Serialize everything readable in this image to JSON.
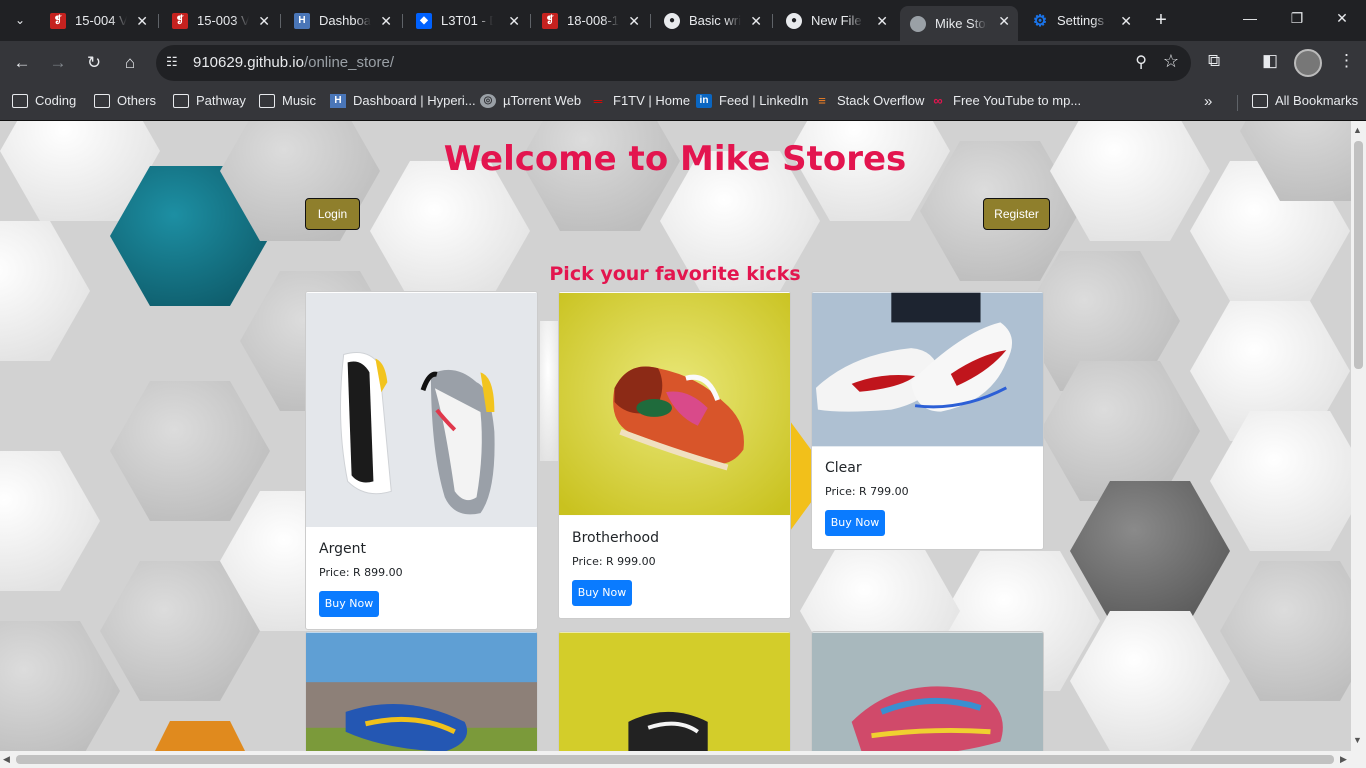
{
  "browser": {
    "tabs": [
      {
        "title": "15-004 Ve",
        "favicon": "pdf-icon",
        "color": "#c5221f"
      },
      {
        "title": "15-003 Ve",
        "favicon": "pdf-icon",
        "color": "#c5221f"
      },
      {
        "title": "Dashboar",
        "favicon": "hyperion-icon",
        "color": "#4a76b8"
      },
      {
        "title": "L3T01 - D",
        "favicon": "dropbox-icon",
        "color": "#0061fe"
      },
      {
        "title": "18-008-1",
        "favicon": "pdf-icon",
        "color": "#c5221f"
      },
      {
        "title": "Basic writ",
        "favicon": "github-icon",
        "color": "#e8eaed"
      },
      {
        "title": "New File",
        "favicon": "github-icon",
        "color": "#e8eaed"
      },
      {
        "title": "Mike Stor",
        "favicon": "globe-icon",
        "color": "#9aa0a6"
      },
      {
        "title": "Settings -",
        "favicon": "gear-icon",
        "color": "#1a73e8"
      }
    ],
    "active_tab_index": 7,
    "url_host": "910629.github.io",
    "url_path": "/online_store/",
    "bookmarks": [
      {
        "label": "Coding",
        "icon": "folder-icon"
      },
      {
        "label": "Others",
        "icon": "folder-icon"
      },
      {
        "label": "Pathway",
        "icon": "folder-icon"
      },
      {
        "label": "Music",
        "icon": "folder-icon"
      },
      {
        "label": "Dashboard | Hyperi...",
        "icon": "hyperion-icon"
      },
      {
        "label": "µTorrent Web",
        "icon": "globe-icon"
      },
      {
        "label": "F1TV | Home",
        "icon": "f1-icon"
      },
      {
        "label": "Feed | LinkedIn",
        "icon": "linkedin-icon"
      },
      {
        "label": "Stack Overflow",
        "icon": "stackoverflow-icon"
      },
      {
        "label": "Free YouTube to mp...",
        "icon": "link-icon"
      }
    ],
    "all_bookmarks_label": "All Bookmarks"
  },
  "page": {
    "title": "Welcome to Mike Stores",
    "login_label": "Login",
    "register_label": "Register",
    "subtitle": "Pick your favorite kicks",
    "accent_color": "#e3154f",
    "button_color": "#8f7f2c",
    "buy_button_color": "#0a7bff",
    "products": [
      {
        "name": "Argent",
        "price": "Price: R 899.00",
        "buy_label": "Buy Now"
      },
      {
        "name": "Brotherhood",
        "price": "Price: R 999.00",
        "buy_label": "Buy Now"
      },
      {
        "name": "Clear",
        "price": "Price: R 799.00",
        "buy_label": "Buy Now"
      }
    ]
  }
}
